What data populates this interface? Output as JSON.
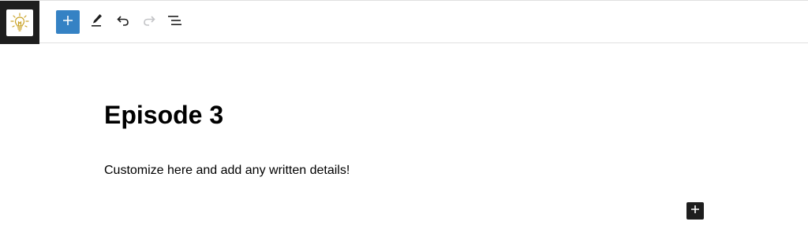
{
  "toolbar": {
    "logo_icon": "lightbulb-icon",
    "inserter_icon": "plus-icon",
    "tools_icon": "pencil-icon",
    "undo_icon": "undo-icon",
    "redo_icon": "redo-icon",
    "outline_icon": "list-view-icon",
    "colors": {
      "logo_background": "#1e1e1e",
      "inserter_background": "#3582c4",
      "icon": "#1e1e1e",
      "icon_disabled": "#c3c4c7"
    }
  },
  "editor": {
    "title": "Episode 3",
    "paragraph": "Customize here and add any written details!",
    "block_add_icon": "plus-icon"
  }
}
